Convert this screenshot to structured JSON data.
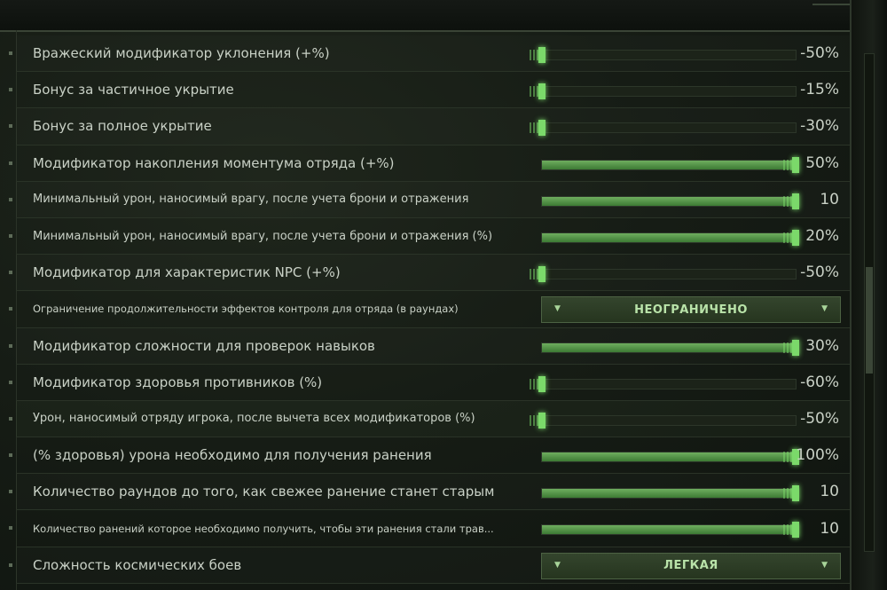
{
  "settings": [
    {
      "label": "Вражеский модификатор уклонения (+%)",
      "type": "slider",
      "fraction": 0.0,
      "value": "-50%"
    },
    {
      "label": "Бонус за частичное укрытие",
      "type": "slider",
      "fraction": 0.0,
      "value": "-15%"
    },
    {
      "label": "Бонус за полное укрытие",
      "type": "slider",
      "fraction": 0.0,
      "value": "-30%"
    },
    {
      "label": "Модификатор накопления моментума отряда (+%)",
      "type": "slider",
      "fraction": 1.0,
      "value": "50%"
    },
    {
      "label": "Минимальный урон, наносимый врагу, после учета брони и отражения",
      "type": "slider",
      "fraction": 1.0,
      "value": "10"
    },
    {
      "label": "Минимальный урон, наносимый врагу, после учета брони и отражения (%)",
      "type": "slider",
      "fraction": 1.0,
      "value": "20%"
    },
    {
      "label": "Модификатор для характеристик NPC (+%)",
      "type": "slider",
      "fraction": 0.0,
      "value": "-50%"
    },
    {
      "label": "Ограничение продолжительности эффектов контроля для отряда (в раундах)",
      "type": "dropdown",
      "value": "НЕОГРАНИЧЕНО"
    },
    {
      "label": "Модификатор сложности для проверок навыков",
      "type": "slider",
      "fraction": 1.0,
      "value": "30%"
    },
    {
      "label": "Модификатор здоровья противников (%)",
      "type": "slider",
      "fraction": 0.0,
      "value": "-60%"
    },
    {
      "label": "Урон, наносимый отряду игрока, после вычета всех модификаторов (%)",
      "type": "slider",
      "fraction": 0.0,
      "value": "-50%"
    },
    {
      "label": "(% здоровья) урона необходимо для получения ранения",
      "type": "slider",
      "fraction": 1.0,
      "value": "100%"
    },
    {
      "label": "Количество раундов до того, как свежее ранение станет старым",
      "type": "slider",
      "fraction": 1.0,
      "value": "10"
    },
    {
      "label": "Количество ранений которое необходимо получить, чтобы эти ранения стали трав...",
      "type": "slider",
      "fraction": 1.0,
      "value": "10"
    },
    {
      "label": "Сложность космических боев",
      "type": "dropdown",
      "value": "ЛЕГКАЯ"
    }
  ],
  "colors": {
    "accent": "#7bd96a",
    "text": "#c9d1c6",
    "dropdown_bg": "#2e3f27"
  },
  "icons": {
    "dropdown_left": "chevron-down-icon",
    "dropdown_right": "chevron-down-icon"
  }
}
